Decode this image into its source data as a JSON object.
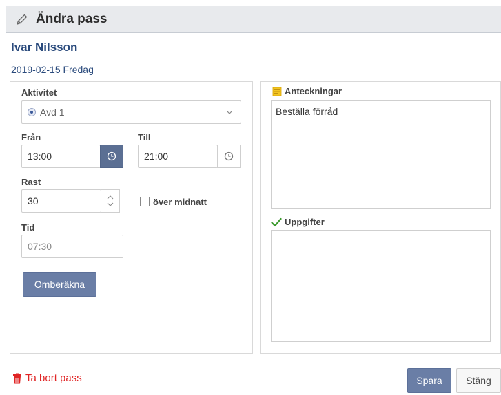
{
  "header": {
    "title": "Ändra pass",
    "icon": "pencil-icon"
  },
  "person": {
    "name": "Ivar Nilsson",
    "date": "2019-02-15 Fredag"
  },
  "form": {
    "activity_label": "Aktivitet",
    "activity_value": "Avd 1",
    "from_label": "Från",
    "from_value": "13:00",
    "to_label": "Till",
    "to_value": "21:00",
    "break_label": "Rast",
    "break_value": "30",
    "overnight_label": "över midnatt",
    "overnight_checked": false,
    "time_label": "Tid",
    "time_value": "07:30",
    "recalc_label": "Omberäkna"
  },
  "notes": {
    "notes_label": "Anteckningar",
    "notes_text": "Beställa förråd",
    "tasks_label": "Uppgifter",
    "tasks_text": ""
  },
  "footer": {
    "delete_label": "Ta bort pass",
    "save_label": "Spara",
    "close_label": "Stäng"
  },
  "colors": {
    "primary": "#5b6f93",
    "button": "#6a7ea6",
    "link": "#2a4a7c",
    "danger": "#e02424",
    "check": "#3c9a2e",
    "note_icon": "#f3c623"
  }
}
